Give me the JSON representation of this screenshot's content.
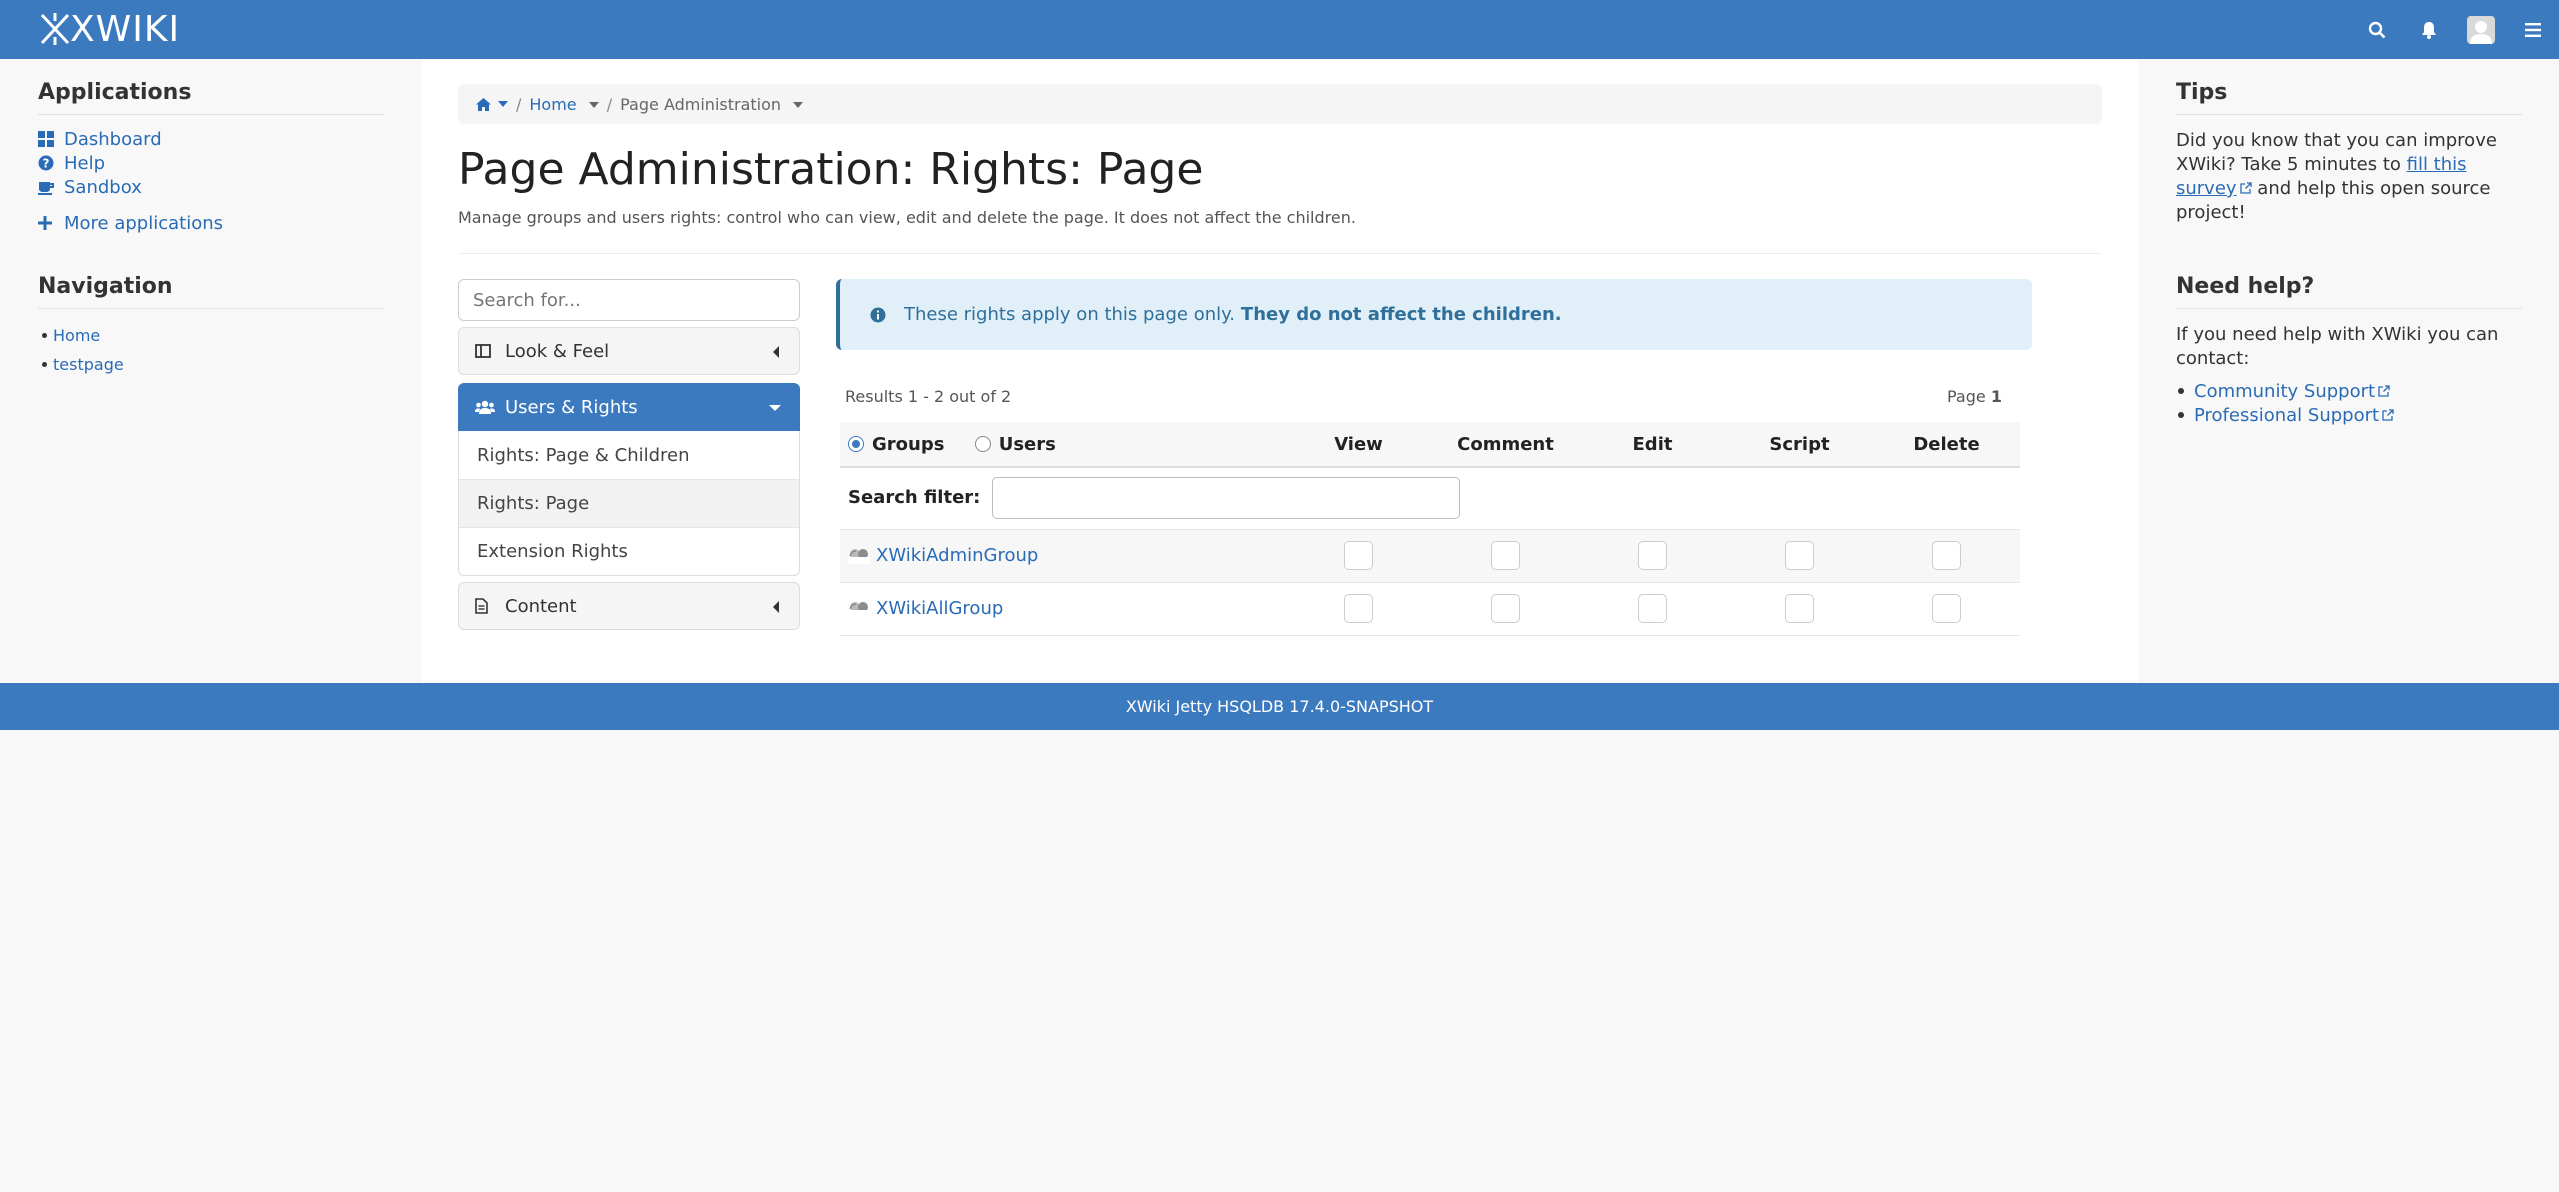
{
  "topbar": {
    "logo": "XWIKI",
    "icons": [
      "search-icon",
      "bell-icon",
      "user-avatar",
      "menu-icon"
    ]
  },
  "left": {
    "applications_title": "Applications",
    "apps": [
      {
        "label": "Dashboard",
        "icon": "dashboard-icon"
      },
      {
        "label": "Help",
        "icon": "question-icon"
      },
      {
        "label": "Sandbox",
        "icon": "cup-icon"
      }
    ],
    "more_apps": "More applications",
    "navigation_title": "Navigation",
    "nav_items": [
      "Home",
      "testpage"
    ]
  },
  "breadcrumb": {
    "home": "Home",
    "current": "Page Administration",
    "sep": "/"
  },
  "page": {
    "title": "Page Administration: Rights: Page",
    "description": "Manage groups and users rights: control who can view, edit and delete the page. It does not affect the children."
  },
  "admin_menu": {
    "search_placeholder": "Search for...",
    "look_feel": "Look & Feel",
    "users_rights": "Users & Rights",
    "sub_items": [
      "Rights: Page & Children",
      "Rights: Page",
      "Extension Rights"
    ],
    "content": "Content"
  },
  "info": {
    "text": "These rights apply on this page only.",
    "bold": "They do not affect the children."
  },
  "rights": {
    "results": "Results 1 - 2 out of 2",
    "page_label": "Page",
    "page_number": "1",
    "groups_label": "Groups",
    "users_label": "Users",
    "columns": [
      "View",
      "Comment",
      "Edit",
      "Script",
      "Delete"
    ],
    "search_filter": "Search filter:",
    "rows": [
      "XWikiAdminGroup",
      "XWikiAllGroup"
    ]
  },
  "right": {
    "tips_title": "Tips",
    "tips_before": "Did you know that you can improve XWiki? Take 5 minutes to ",
    "tips_link": "fill this survey",
    "tips_after": " and help this open source project!",
    "help_title": "Need help?",
    "help_text": "If you need help with XWiki you can contact:",
    "help_links": [
      "Community Support",
      "Professional Support"
    ]
  },
  "footer": {
    "text": "XWiki Jetty HSQLDB 17.4.0-SNAPSHOT"
  },
  "colors": {
    "brand": "#3c7abf",
    "link": "#2a6bb5",
    "info_bg": "#e1f0f8"
  }
}
